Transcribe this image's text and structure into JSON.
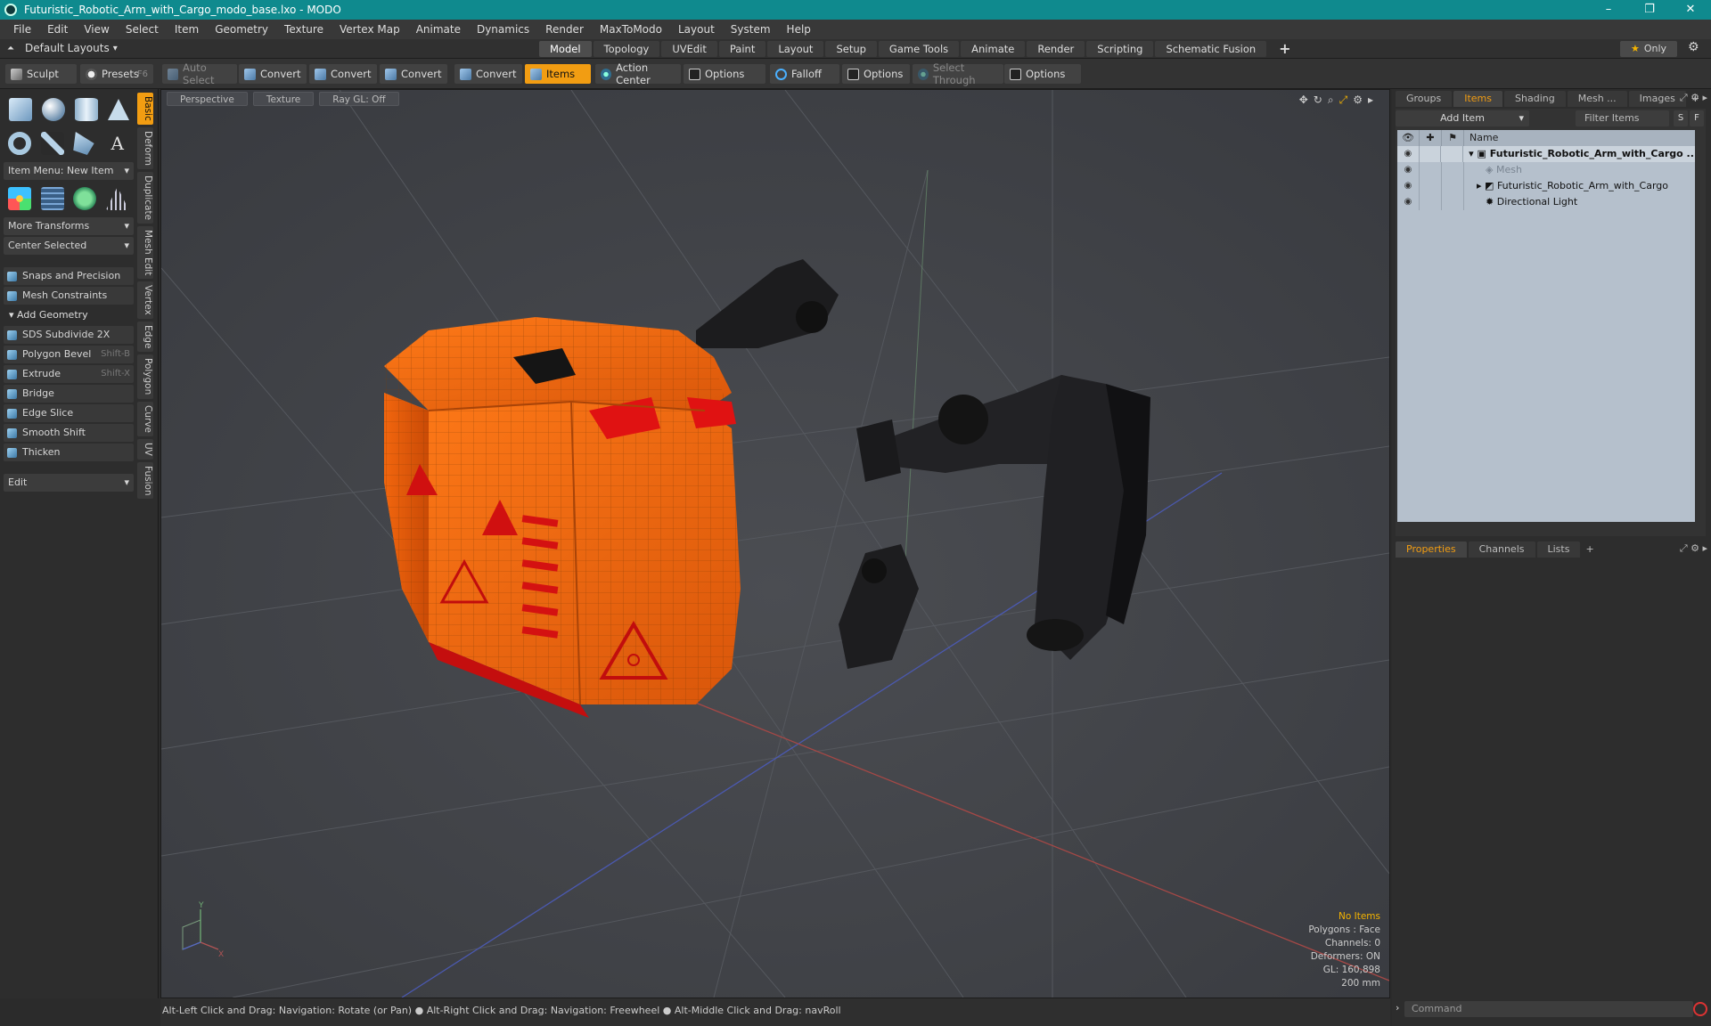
{
  "window": {
    "title": "Futuristic_Robotic_Arm_with_Cargo_modo_base.lxo - MODO",
    "minimize": "–",
    "restore": "❐",
    "close": "✕"
  },
  "menu": [
    "File",
    "Edit",
    "View",
    "Select",
    "Item",
    "Geometry",
    "Texture",
    "Vertex Map",
    "Animate",
    "Dynamics",
    "Render",
    "MaxToModo",
    "Layout",
    "System",
    "Help"
  ],
  "layout": {
    "default_layouts": "Default Layouts",
    "tabs": [
      "Model",
      "Topology",
      "UVEdit",
      "Paint",
      "Layout",
      "Setup",
      "Game Tools",
      "Animate",
      "Render",
      "Scripting",
      "Schematic Fusion"
    ],
    "active_tab": "Model",
    "plus": "+",
    "only": "Only"
  },
  "toolbar": {
    "sculpt": "Sculpt",
    "presets": "Presets",
    "presets_key": "F6",
    "auto_select": "Auto Select",
    "convert1": "Convert",
    "convert2": "Convert",
    "convert3": "Convert",
    "convert4": "Convert",
    "items": "Items",
    "action_center": "Action Center",
    "options1": "Options",
    "falloff": "Falloff",
    "options2": "Options",
    "select_through": "Select Through",
    "options3": "Options"
  },
  "left_panel": {
    "item_menu": "Item Menu: New Item",
    "more_transforms": "More Transforms",
    "center_selected": "Center Selected",
    "snaps": "Snaps and Precision",
    "mesh_constraints": "Mesh Constraints",
    "add_geometry": "Add Geometry",
    "tools": [
      {
        "label": "SDS Subdivide 2X",
        "key": ""
      },
      {
        "label": "Polygon Bevel",
        "key": "Shift-B"
      },
      {
        "label": "Extrude",
        "key": "Shift-X"
      },
      {
        "label": "Bridge",
        "key": ""
      },
      {
        "label": "Edge Slice",
        "key": ""
      },
      {
        "label": "Smooth Shift",
        "key": ""
      },
      {
        "label": "Thicken",
        "key": ""
      }
    ],
    "edit": "Edit",
    "side_tabs": [
      "Basic",
      "Deform",
      "Duplicate",
      "Mesh Edit",
      "Vertex",
      "Edge",
      "Polygon",
      "Curve",
      "UV",
      "Fusion"
    ]
  },
  "viewport": {
    "view": "Perspective",
    "shading": "Texture",
    "raygl": "Ray GL: Off",
    "info": {
      "items": "No Items",
      "polygons": "Polygons : Face",
      "channels": "Channels: 0",
      "deformers": "Deformers: ON",
      "gl": "GL: 160,898",
      "scale": "200 mm"
    },
    "axis_y": "Y",
    "axis_x": "X"
  },
  "status": "Alt-Left Click and Drag: Navigation: Rotate (or Pan) ● Alt-Right Click and Drag: Navigation: Freewheel ● Alt-Middle Click and Drag: navRoll",
  "right_panel": {
    "tabs_top": [
      "Groups",
      "Items",
      "Shading",
      "Mesh ...",
      "Images"
    ],
    "active_top": "Items",
    "add_item": "Add Item",
    "filter_items": "Filter Items",
    "s_btn": "S",
    "f_btn": "F",
    "name_header": "Name",
    "tree": [
      {
        "name": "Futuristic_Robotic_Arm_with_Cargo ...",
        "style": "bold"
      },
      {
        "name": "Mesh",
        "style": "muted"
      },
      {
        "name": "Futuristic_Robotic_Arm_with_Cargo",
        "style": "normal"
      },
      {
        "name": "Directional Light",
        "style": "normal"
      }
    ],
    "tabs_bottom": [
      "Properties",
      "Channels",
      "Lists"
    ],
    "active_bottom": "Properties",
    "command": "Command"
  },
  "colors": {
    "accent": "#f29d12",
    "titlebar": "#0f8a8e",
    "cargo": "#f06a10",
    "cargo_red": "#e01010",
    "arm": "#1e1e1e"
  }
}
